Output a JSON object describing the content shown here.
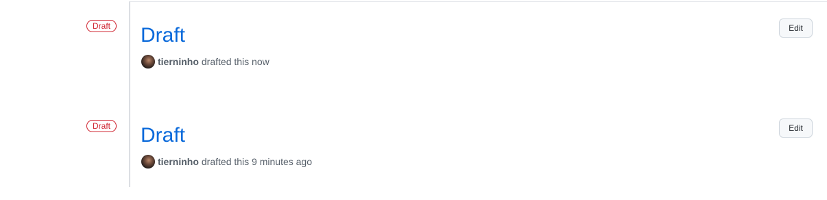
{
  "releases": [
    {
      "badge": "Draft",
      "title": "Draft",
      "author": "tierninho",
      "action_text": "drafted this now",
      "edit_label": "Edit"
    },
    {
      "badge": "Draft",
      "title": "Draft",
      "author": "tierninho",
      "action_text": "drafted this 9 minutes ago",
      "edit_label": "Edit"
    }
  ],
  "colors": {
    "link": "#0969da",
    "draft_badge": "#cf222e",
    "muted_text": "#57606a",
    "timeline": "#dcdfe3"
  }
}
